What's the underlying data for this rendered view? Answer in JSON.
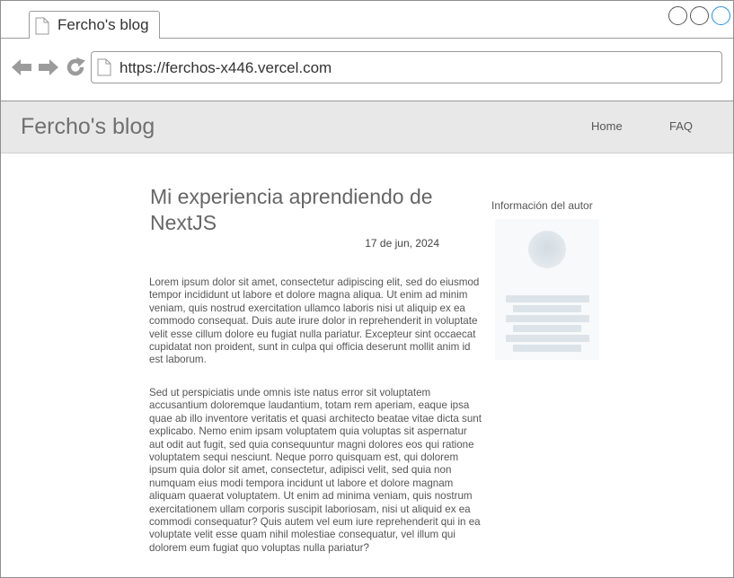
{
  "browser": {
    "tab_title": "Fercho's blog",
    "url": "https://ferchos-x446.vercel.com",
    "icons": [
      "doc-icon",
      "back-arrow-icon",
      "forward-arrow-icon",
      "reload-icon"
    ]
  },
  "site": {
    "brand": "Fercho's blog",
    "nav": [
      {
        "label": "Home"
      },
      {
        "label": "FAQ"
      }
    ]
  },
  "post": {
    "title": "Mi experiencia aprendiendo de NextJS",
    "date": "17 de jun, 2024",
    "paragraphs": [
      "Lorem ipsum dolor sit amet, consectetur adipiscing elit, sed do eiusmod tempor incididunt ut labore et dolore magna aliqua. Ut enim ad minim veniam, quis nostrud exercitation ullamco laboris nisi ut aliquip ex ea commodo consequat. Duis aute irure dolor in reprehenderit in voluptate velit esse cillum dolore eu fugiat nulla pariatur. Excepteur sint occaecat cupidatat non proident, sunt in culpa qui officia deserunt mollit anim id est laborum.",
      "Sed ut perspiciatis unde omnis iste natus error sit voluptatem accusantium doloremque laudantium, totam rem aperiam, eaque ipsa quae ab illo inventore veritatis et quasi architecto beatae vitae dicta sunt explicabo. Nemo enim ipsam voluptatem quia voluptas sit aspernatur aut odit aut fugit, sed quia consequuntur magni dolores eos qui ratione voluptatem sequi nesciunt. Neque porro quisquam est, qui dolorem ipsum quia dolor sit amet, consectetur, adipisci velit, sed quia non numquam eius modi tempora incidunt ut labore et dolore magnam aliquam quaerat voluptatem. Ut enim ad minima veniam, quis nostrum exercitationem ullam corporis suscipit laboriosam, nisi ut aliquid ex ea commodi consequatur? Quis autem vel eum iure reprehenderit qui in ea voluptate velit esse quam nihil molestiae consequatur, vel illum qui dolorem eum fugiat quo voluptas nulla pariatur?"
    ]
  },
  "sidebar": {
    "author_title": "Información del autor"
  },
  "colors": {
    "header_bg": "#e8e8e8",
    "accent_circle": "#2a8fd6"
  }
}
